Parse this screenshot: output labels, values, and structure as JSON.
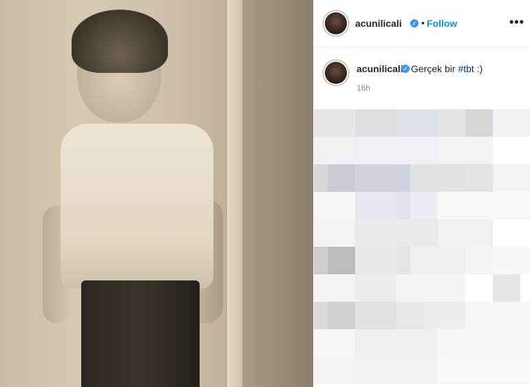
{
  "post": {
    "username": "acunilicali",
    "follow_label": "Follow",
    "separator": "•",
    "more_label": "•••",
    "verified_glyph": "✓"
  },
  "comment": {
    "username": "acunilicali",
    "caption_text": "Gerçek bir ",
    "hashtag": "#tbt",
    "caption_suffix": " :)",
    "time": "16h"
  },
  "colors": {
    "follow": "#0095f6",
    "verified": "#3897f0",
    "text": "#262626",
    "muted": "#8e8e8e"
  },
  "icons": [
    "verified-badge-icon",
    "more-options-icon"
  ]
}
